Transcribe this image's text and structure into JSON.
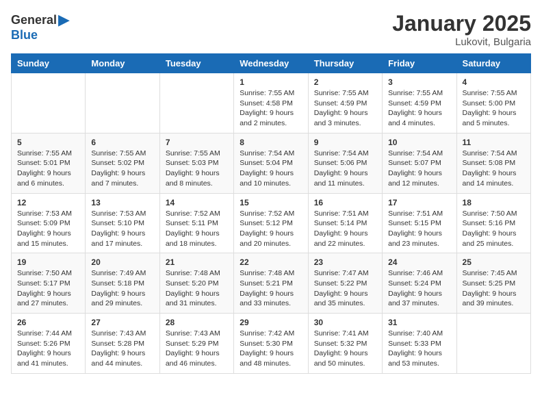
{
  "header": {
    "logo_general": "General",
    "logo_blue": "Blue",
    "title": "January 2025",
    "subtitle": "Lukovit, Bulgaria"
  },
  "days_of_week": [
    "Sunday",
    "Monday",
    "Tuesday",
    "Wednesday",
    "Thursday",
    "Friday",
    "Saturday"
  ],
  "weeks": [
    [
      {
        "day": "",
        "content": ""
      },
      {
        "day": "",
        "content": ""
      },
      {
        "day": "",
        "content": ""
      },
      {
        "day": "1",
        "content": "Sunrise: 7:55 AM\nSunset: 4:58 PM\nDaylight: 9 hours and 2 minutes."
      },
      {
        "day": "2",
        "content": "Sunrise: 7:55 AM\nSunset: 4:59 PM\nDaylight: 9 hours and 3 minutes."
      },
      {
        "day": "3",
        "content": "Sunrise: 7:55 AM\nSunset: 4:59 PM\nDaylight: 9 hours and 4 minutes."
      },
      {
        "day": "4",
        "content": "Sunrise: 7:55 AM\nSunset: 5:00 PM\nDaylight: 9 hours and 5 minutes."
      }
    ],
    [
      {
        "day": "5",
        "content": "Sunrise: 7:55 AM\nSunset: 5:01 PM\nDaylight: 9 hours and 6 minutes."
      },
      {
        "day": "6",
        "content": "Sunrise: 7:55 AM\nSunset: 5:02 PM\nDaylight: 9 hours and 7 minutes."
      },
      {
        "day": "7",
        "content": "Sunrise: 7:55 AM\nSunset: 5:03 PM\nDaylight: 9 hours and 8 minutes."
      },
      {
        "day": "8",
        "content": "Sunrise: 7:54 AM\nSunset: 5:04 PM\nDaylight: 9 hours and 10 minutes."
      },
      {
        "day": "9",
        "content": "Sunrise: 7:54 AM\nSunset: 5:06 PM\nDaylight: 9 hours and 11 minutes."
      },
      {
        "day": "10",
        "content": "Sunrise: 7:54 AM\nSunset: 5:07 PM\nDaylight: 9 hours and 12 minutes."
      },
      {
        "day": "11",
        "content": "Sunrise: 7:54 AM\nSunset: 5:08 PM\nDaylight: 9 hours and 14 minutes."
      }
    ],
    [
      {
        "day": "12",
        "content": "Sunrise: 7:53 AM\nSunset: 5:09 PM\nDaylight: 9 hours and 15 minutes."
      },
      {
        "day": "13",
        "content": "Sunrise: 7:53 AM\nSunset: 5:10 PM\nDaylight: 9 hours and 17 minutes."
      },
      {
        "day": "14",
        "content": "Sunrise: 7:52 AM\nSunset: 5:11 PM\nDaylight: 9 hours and 18 minutes."
      },
      {
        "day": "15",
        "content": "Sunrise: 7:52 AM\nSunset: 5:12 PM\nDaylight: 9 hours and 20 minutes."
      },
      {
        "day": "16",
        "content": "Sunrise: 7:51 AM\nSunset: 5:14 PM\nDaylight: 9 hours and 22 minutes."
      },
      {
        "day": "17",
        "content": "Sunrise: 7:51 AM\nSunset: 5:15 PM\nDaylight: 9 hours and 23 minutes."
      },
      {
        "day": "18",
        "content": "Sunrise: 7:50 AM\nSunset: 5:16 PM\nDaylight: 9 hours and 25 minutes."
      }
    ],
    [
      {
        "day": "19",
        "content": "Sunrise: 7:50 AM\nSunset: 5:17 PM\nDaylight: 9 hours and 27 minutes."
      },
      {
        "day": "20",
        "content": "Sunrise: 7:49 AM\nSunset: 5:18 PM\nDaylight: 9 hours and 29 minutes."
      },
      {
        "day": "21",
        "content": "Sunrise: 7:48 AM\nSunset: 5:20 PM\nDaylight: 9 hours and 31 minutes."
      },
      {
        "day": "22",
        "content": "Sunrise: 7:48 AM\nSunset: 5:21 PM\nDaylight: 9 hours and 33 minutes."
      },
      {
        "day": "23",
        "content": "Sunrise: 7:47 AM\nSunset: 5:22 PM\nDaylight: 9 hours and 35 minutes."
      },
      {
        "day": "24",
        "content": "Sunrise: 7:46 AM\nSunset: 5:24 PM\nDaylight: 9 hours and 37 minutes."
      },
      {
        "day": "25",
        "content": "Sunrise: 7:45 AM\nSunset: 5:25 PM\nDaylight: 9 hours and 39 minutes."
      }
    ],
    [
      {
        "day": "26",
        "content": "Sunrise: 7:44 AM\nSunset: 5:26 PM\nDaylight: 9 hours and 41 minutes."
      },
      {
        "day": "27",
        "content": "Sunrise: 7:43 AM\nSunset: 5:28 PM\nDaylight: 9 hours and 44 minutes."
      },
      {
        "day": "28",
        "content": "Sunrise: 7:43 AM\nSunset: 5:29 PM\nDaylight: 9 hours and 46 minutes."
      },
      {
        "day": "29",
        "content": "Sunrise: 7:42 AM\nSunset: 5:30 PM\nDaylight: 9 hours and 48 minutes."
      },
      {
        "day": "30",
        "content": "Sunrise: 7:41 AM\nSunset: 5:32 PM\nDaylight: 9 hours and 50 minutes."
      },
      {
        "day": "31",
        "content": "Sunrise: 7:40 AM\nSunset: 5:33 PM\nDaylight: 9 hours and 53 minutes."
      },
      {
        "day": "",
        "content": ""
      }
    ]
  ]
}
